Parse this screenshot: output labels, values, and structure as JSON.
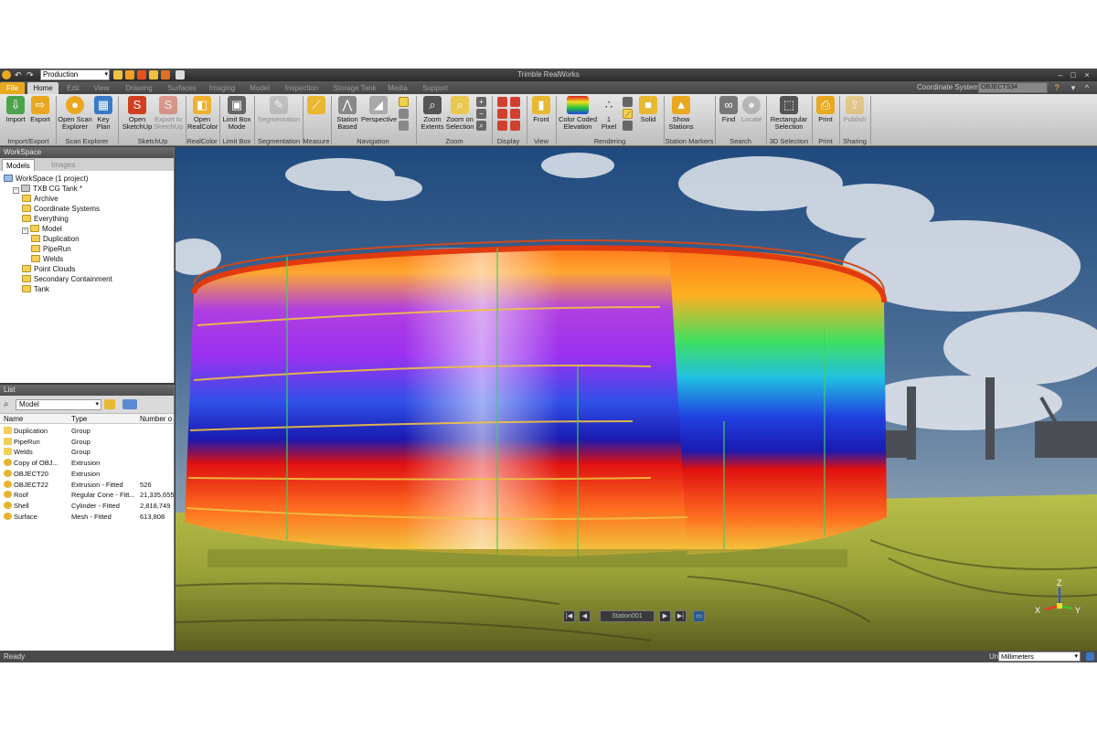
{
  "titlebar": {
    "profile": "Production",
    "app_title": "Trimble RealWorks"
  },
  "tabs": [
    "File",
    "Home",
    "Edit",
    "View",
    "Drawing",
    "Surfaces",
    "Imaging",
    "Model",
    "Inspection",
    "Storage Tank",
    "Media",
    "Support"
  ],
  "coordinate_system": {
    "label": "Coordinate System",
    "value": "OBJECTS34"
  },
  "ribbon": {
    "buttons": {
      "import": "Import",
      "export": "Export",
      "open_scan_explorer": "Open Scan Explorer",
      "key_plan": "Key Plan",
      "open_sketchup": "Open SketchUp",
      "export_to_sketchup": "Export to SketchUp",
      "open_realcolor": "Open RealColor",
      "limit_box_mode": "Limit Box Mode",
      "segmentation": "Segmentation",
      "station_based": "Station Based",
      "perspective": "Perspective",
      "zoom_extents": "Zoom Extents",
      "zoom_on_selection": "Zoom on Selection",
      "front": "Front",
      "color_coded_elevation": "Color Coded Elevation",
      "pixel_size": "1 Pixel",
      "solid": "Solid",
      "show_stations": "Show Stations",
      "find": "Find",
      "locate": "Locate",
      "rectangular_selection": "Rectangular Selection",
      "print": "Print",
      "publish": "Publish"
    },
    "groups": {
      "import_export": "Import/Export",
      "scan_explorer": "Scan Explorer",
      "sketchup": "SketchUp",
      "realcolor": "RealColor",
      "limit_box": "Limit Box",
      "segmentation": "Segmentation",
      "measure": "Measure",
      "navigation": "Navigation",
      "zoom": "Zoom",
      "display": "Display",
      "view": "View",
      "rendering": "Rendering",
      "station_markers": "Station Markers",
      "search": "Search",
      "selection_3d": "3D Selection",
      "print": "Print",
      "sharing": "Sharing"
    }
  },
  "workspace": {
    "title": "WorkSpace",
    "tabs": [
      "Models",
      "Images"
    ],
    "tree": [
      {
        "label": "WorkSpace (1 project)",
        "level": 0,
        "icon": "workspace-icon"
      },
      {
        "label": "TXB CG Tank *",
        "level": 1,
        "icon": "project-icon"
      },
      {
        "label": "Archive",
        "level": 2,
        "icon": "folder-icon"
      },
      {
        "label": "Coordinate Systems",
        "level": 2,
        "icon": "folder-icon"
      },
      {
        "label": "Everything",
        "level": 2,
        "icon": "folder-icon"
      },
      {
        "label": "Model",
        "level": 2,
        "icon": "folder-icon"
      },
      {
        "label": "Duplication",
        "level": 3,
        "icon": "folder-icon"
      },
      {
        "label": "PipeRun",
        "level": 3,
        "icon": "folder-icon"
      },
      {
        "label": "Welds",
        "level": 3,
        "icon": "folder-icon"
      },
      {
        "label": "Point Clouds",
        "level": 2,
        "icon": "folder-icon"
      },
      {
        "label": "Secondary Containment",
        "level": 2,
        "icon": "folder-icon"
      },
      {
        "label": "Tank",
        "level": 2,
        "icon": "folder-icon"
      }
    ]
  },
  "list": {
    "title": "List",
    "filter": "Model",
    "columns": [
      "Name",
      "Type",
      "Number o"
    ],
    "rows": [
      {
        "name": "Duplication",
        "type": "Group",
        "number": ""
      },
      {
        "name": "PipeRun",
        "type": "Group",
        "number": ""
      },
      {
        "name": "Welds",
        "type": "Group",
        "number": ""
      },
      {
        "name": "Copy of OBJ...",
        "type": "Extrusion",
        "number": ""
      },
      {
        "name": "OBJECT20",
        "type": "Extrusion",
        "number": ""
      },
      {
        "name": "OBJECT22",
        "type": "Extrusion - Fitted",
        "number": "526"
      },
      {
        "name": "Roof",
        "type": "Regular Cone - Fitt...",
        "number": "21,335,655"
      },
      {
        "name": "Shell",
        "type": "Cylinder - Fitted",
        "number": "2,818,749"
      },
      {
        "name": "Surface",
        "type": "Mesh - Fitted",
        "number": "613,808"
      }
    ]
  },
  "viewport": {
    "station_field": "Station001",
    "axis_labels": {
      "z": "Z",
      "x": "X",
      "y": "Y"
    },
    "colors": {
      "sky": "#2f5a8a",
      "ground": "#c8d24a",
      "tank_top": "#ff8a2a",
      "tank_mid": "#8a2be2",
      "tank_bottom": "#e8201a"
    }
  },
  "status": {
    "text": "Ready",
    "units_label": "Un",
    "units_value": "Millimeters"
  }
}
